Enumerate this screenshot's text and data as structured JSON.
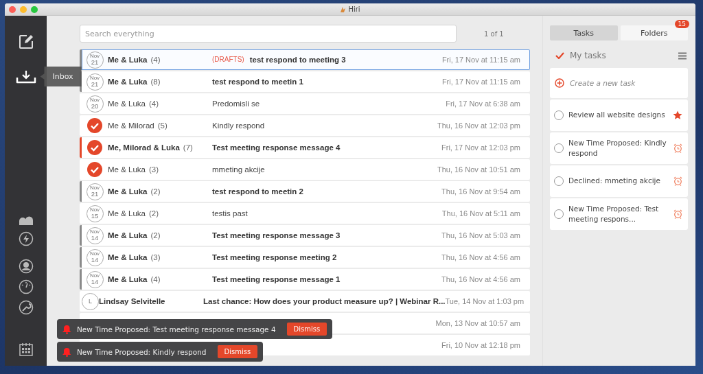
{
  "window": {
    "title": "Hiri"
  },
  "sidebar": {
    "tooltip": "Inbox"
  },
  "search": {
    "placeholder": "Search everything"
  },
  "pagination": "1 of 1",
  "messages": [
    {
      "avatar": {
        "kind": "date",
        "month": "Nov",
        "day": "21"
      },
      "sender": "Me & Luka",
      "count": "(4)",
      "tag": "(DRAFTS)",
      "subject": "test respond to meeting 3",
      "date": "Fri, 17 Nov at 11:15 am",
      "unread": true,
      "color": "#8a8a8a",
      "selected": true
    },
    {
      "avatar": {
        "kind": "date",
        "month": "Nov",
        "day": "21"
      },
      "sender": "Me & Luka",
      "count": "(8)",
      "subject": "test respond to meetin 1",
      "date": "Fri, 17 Nov at 11:15 am",
      "unread": true,
      "color": "#8a8a8a",
      "selected": false
    },
    {
      "avatar": {
        "kind": "date",
        "month": "Nov",
        "day": "20"
      },
      "sender": "Me & Luka",
      "count": "(4)",
      "subject": "Predomisli se",
      "date": "Fri, 17 Nov at 6:38 am",
      "unread": false,
      "selected": false
    },
    {
      "avatar": {
        "kind": "done"
      },
      "sender": "Me & Milorad",
      "count": "(5)",
      "subject": "Kindly respond",
      "date": "Thu, 16 Nov at 12:03 pm",
      "unread": false,
      "selected": false
    },
    {
      "avatar": {
        "kind": "done"
      },
      "sender": "Me, Milorad & Luka",
      "count": "(7)",
      "subject": "Test meeting response message 4",
      "date": "Fri, 17 Nov at 12:03 pm",
      "unread": true,
      "color": "#e4472a",
      "selected": false
    },
    {
      "avatar": {
        "kind": "done"
      },
      "sender": "Me & Luka",
      "count": "(3)",
      "subject": "mmeting akcije",
      "date": "Thu, 16 Nov at 10:51 am",
      "unread": false,
      "selected": false
    },
    {
      "avatar": {
        "kind": "date",
        "month": "Nov",
        "day": "21"
      },
      "sender": "Me & Luka",
      "count": "(2)",
      "subject": "test respond to meetin 2",
      "date": "Thu, 16 Nov at 9:54 am",
      "unread": true,
      "color": "#8a8a8a",
      "selected": false
    },
    {
      "avatar": {
        "kind": "date",
        "month": "Nov",
        "day": "15"
      },
      "sender": "Me & Luka",
      "count": "(2)",
      "subject": "testis past",
      "date": "Thu, 16 Nov at 5:11 am",
      "unread": false,
      "selected": false
    },
    {
      "avatar": {
        "kind": "date",
        "month": "Nov",
        "day": "14"
      },
      "sender": "Me & Luka",
      "count": "(2)",
      "subject": "Test meeting response message 3",
      "date": "Thu, 16 Nov at 5:03 am",
      "unread": true,
      "color": "#8a8a8a",
      "selected": false
    },
    {
      "avatar": {
        "kind": "date",
        "month": "Nov",
        "day": "14"
      },
      "sender": "Me & Luka",
      "count": "(3)",
      "subject": "Test meeting response meeting 2",
      "date": "Thu, 16 Nov at 4:56 am",
      "unread": true,
      "color": "#8a8a8a",
      "selected": false
    },
    {
      "avatar": {
        "kind": "date",
        "month": "Nov",
        "day": "14"
      },
      "sender": "Me & Luka",
      "count": "(4)",
      "subject": "Test meeting response message 1",
      "date": "Thu, 16 Nov at 4:56 am",
      "unread": true,
      "color": "#8a8a8a",
      "selected": false
    },
    {
      "avatar": {
        "kind": "letter",
        "letter": "L"
      },
      "sender": "Lindsay Selvitelle",
      "subject": "Last chance: How does your product measure up? | Webinar R...",
      "date": "Tue, 14 Nov at 1:03 pm",
      "unread": true,
      "selected": false
    },
    {
      "date": "Mon, 13 Nov at 10:57 am",
      "selected": false
    },
    {
      "date": "Fri, 10 Nov at 12:18 pm",
      "selected": false
    }
  ],
  "tabs": [
    {
      "label": "Tasks",
      "selected": true
    },
    {
      "label": "Folders",
      "selected": false,
      "badge": "15"
    }
  ],
  "tasks_header": "My tasks",
  "new_task": {
    "placeholder": "Create a new task"
  },
  "tasks": [
    {
      "text": "Review all website designs",
      "kind": "starred",
      "checked": false
    },
    {
      "text": "New Time Proposed: Kindly respond",
      "kind": "reminder",
      "checked": false
    },
    {
      "text": "Declined: mmeting akcije",
      "kind": "reminder",
      "checked": false
    },
    {
      "text": "New Time Proposed: Test meeting respons...",
      "kind": "reminder",
      "checked": false
    }
  ],
  "notifications": [
    {
      "text": "New Time Proposed: Test meeting response message 4",
      "button": "Dismiss"
    },
    {
      "text": "New Time Proposed: Kindly respond",
      "button": "Dismiss"
    }
  ]
}
